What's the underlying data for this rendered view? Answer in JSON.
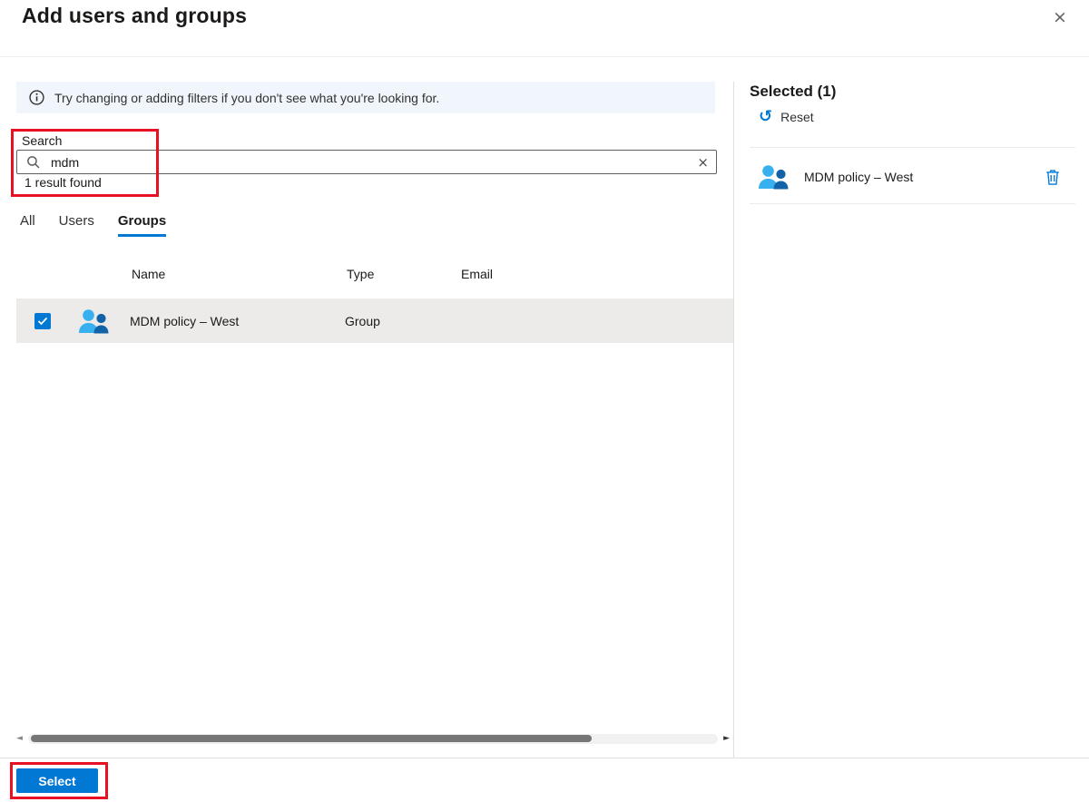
{
  "dialog": {
    "title": "Add users and groups"
  },
  "banner": {
    "text": "Try changing or adding filters if you don't see what you're looking for."
  },
  "search": {
    "label": "Search",
    "value": "mdm",
    "result_count": "1 result found"
  },
  "tabs": [
    {
      "label": "All",
      "active": false
    },
    {
      "label": "Users",
      "active": false
    },
    {
      "label": "Groups",
      "active": true
    }
  ],
  "table": {
    "headers": [
      "Name",
      "Type",
      "Email"
    ],
    "rows": [
      {
        "name": "MDM policy – West",
        "type": "Group",
        "email": "",
        "checked": true
      }
    ]
  },
  "selected": {
    "title": "Selected (1)",
    "reset": "Reset",
    "items": [
      {
        "name": "MDM policy – West"
      }
    ]
  },
  "footer": {
    "select": "Select"
  },
  "icons": {
    "close": "×",
    "clear": "×",
    "reset": "↺",
    "scroll_left": "◄",
    "scroll_right": "►"
  },
  "colors": {
    "accent": "#0078d4",
    "annotation_red": "#e81123",
    "selected_row_bg": "#edebe9",
    "banner_bg": "#f0f6fc",
    "group_icon_light": "#38b0ef",
    "group_icon_dark": "#1262a8"
  }
}
